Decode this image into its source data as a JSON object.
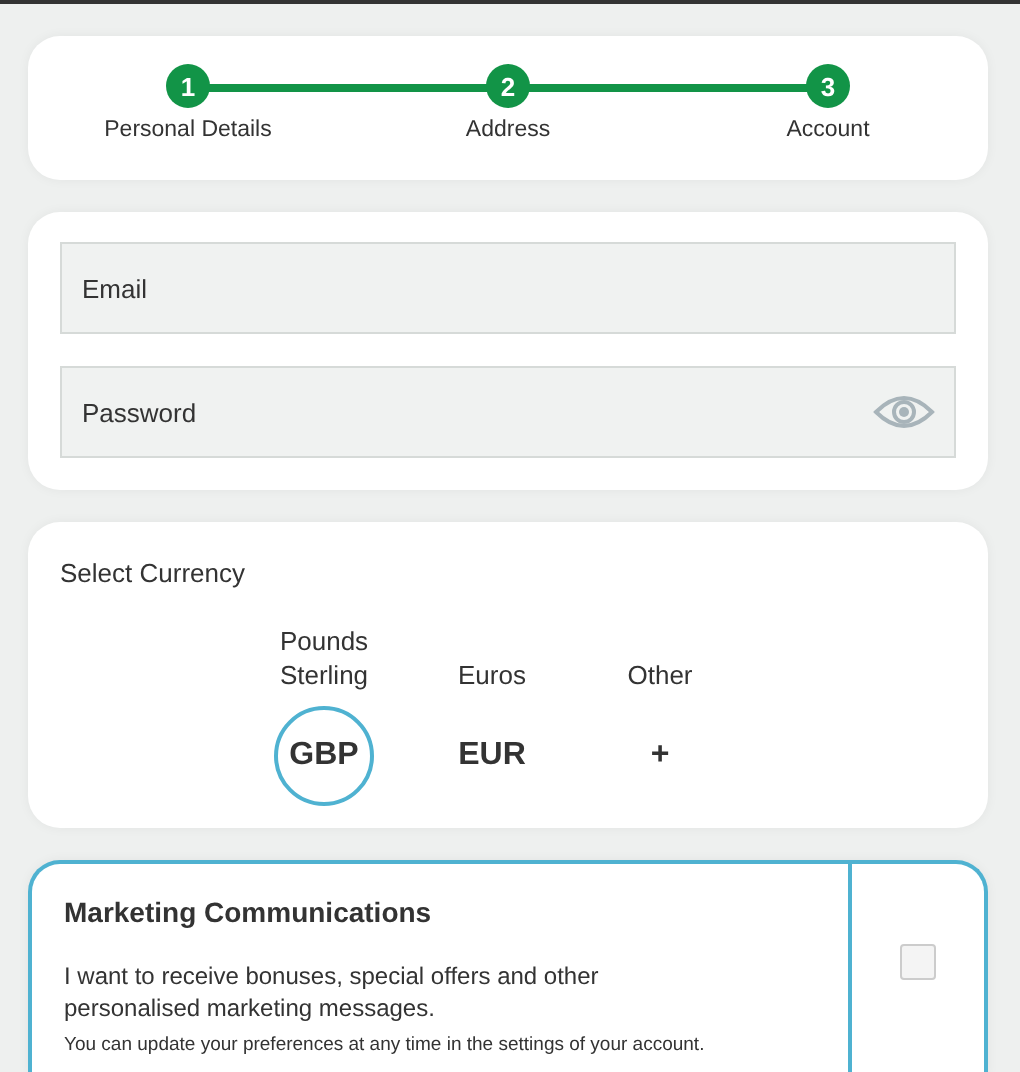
{
  "steps": [
    {
      "number": "1",
      "label": "Personal Details",
      "completed": true
    },
    {
      "number": "2",
      "label": "Address",
      "completed": true
    },
    {
      "number": "3",
      "label": "Account",
      "completed": true
    }
  ],
  "fields": [
    {
      "placeholder": "Email",
      "kind": "text"
    },
    {
      "placeholder": "Password",
      "kind": "password"
    }
  ],
  "currency": {
    "title": "Select Currency",
    "options": [
      {
        "name": "Pounds Sterling",
        "code": "GBP",
        "selected": true
      },
      {
        "name": "Euros",
        "code": "EUR",
        "selected": false
      },
      {
        "name": "Other",
        "code": "+",
        "selected": false
      }
    ]
  },
  "marketing": {
    "title": "Marketing Communications",
    "text": "I want to receive bonuses, special offers and other personalised marketing messages.",
    "note": "You can update your preferences at any time in the settings of your account.",
    "checked": false
  }
}
